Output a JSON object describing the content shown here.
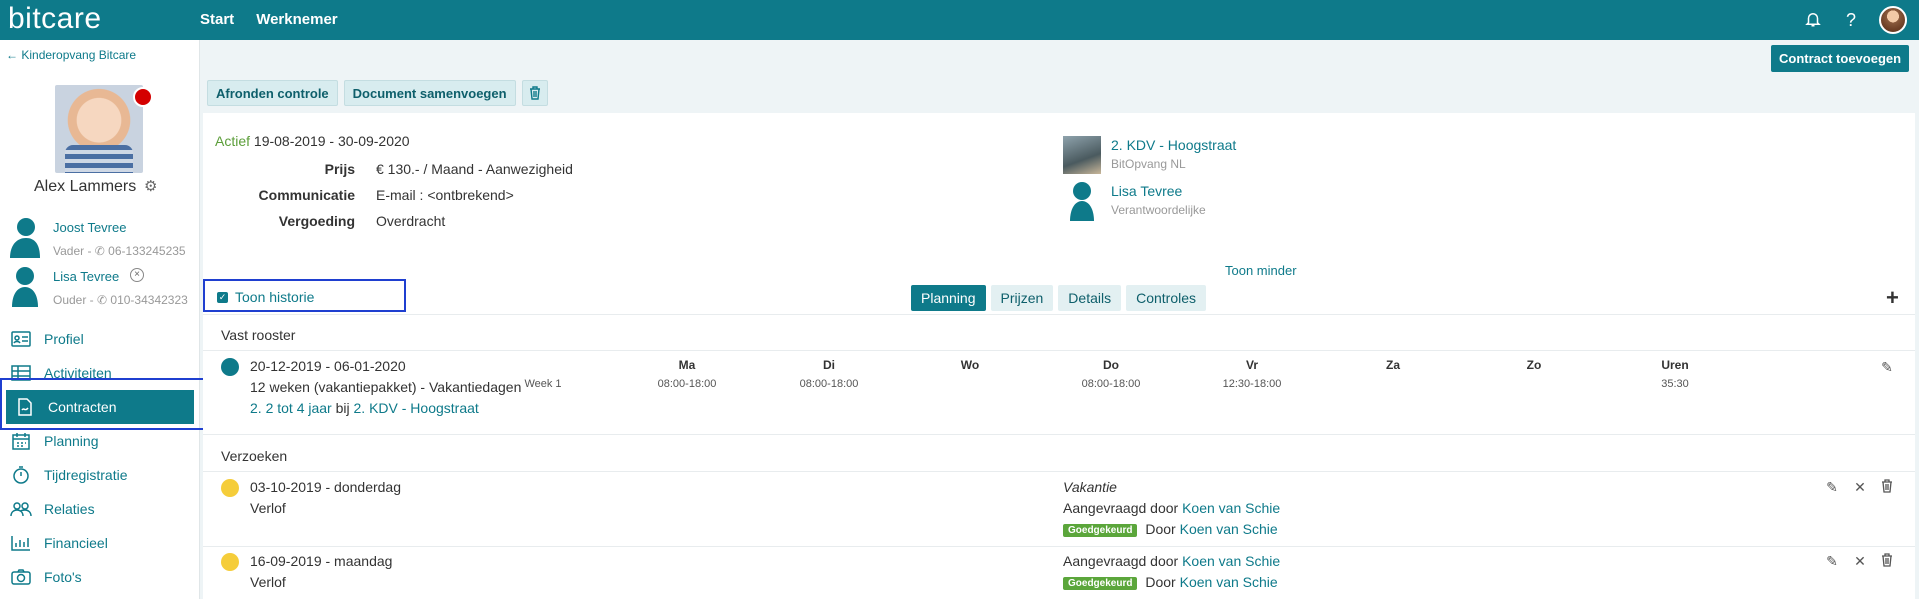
{
  "app": {
    "logo": "bitcare",
    "nav": [
      "Start",
      "Werknemer"
    ]
  },
  "sidebar": {
    "back_label": "Kinderopvang Bitcare",
    "child_name": "Alex Lammers",
    "parents": [
      {
        "name": "Joost Tevree",
        "role": "Vader - ✆ 06-133245235"
      },
      {
        "name": "Lisa Tevree",
        "role": "Ouder - ✆ 010-34342323"
      }
    ],
    "menu": [
      {
        "label": "Profiel",
        "icon": "profile-card-icon"
      },
      {
        "label": "Activiteiten",
        "icon": "table-icon"
      },
      {
        "label": "Contracten",
        "icon": "contract-icon",
        "active": true
      },
      {
        "label": "Planning",
        "icon": "calendar-icon"
      },
      {
        "label": "Tijdregistratie",
        "icon": "stopwatch-icon"
      },
      {
        "label": "Relaties",
        "icon": "people-icon"
      },
      {
        "label": "Financieel",
        "icon": "bar-chart-icon"
      },
      {
        "label": "Foto's",
        "icon": "camera-icon"
      }
    ]
  },
  "header": {
    "add_contract": "Contract toevoegen"
  },
  "toolbar": {
    "finish": "Afronden controle",
    "merge": "Document samenvoegen"
  },
  "contract": {
    "status": "Actief",
    "period": "19-08-2019 - 30-09-2020",
    "fields": [
      {
        "key": "Prijs",
        "value": "€ 130.- / Maand - Aanwezigheid"
      },
      {
        "key": "Communicatie",
        "value": "E-mail : <ontbrekend>"
      },
      {
        "key": "Vergoeding",
        "value": "Overdracht"
      }
    ],
    "location_name": "2. KDV - Hoogstraat",
    "location_org": "BitOpvang NL",
    "responsible_name": "Lisa Tevree",
    "responsible_role": "Verantwoordelijke",
    "toggle_less": "Toon minder",
    "history_label": "Toon historie",
    "tabs": [
      "Planning",
      "Prijzen",
      "Details",
      "Controles"
    ]
  },
  "schedule": {
    "title": "Vast rooster",
    "period": "20-12-2019 - 06-01-2020",
    "package": "12 weken (vakantiepakket) - Vakantiedagen",
    "group_link": "2. 2 tot 4 jaar",
    "group_mid": "bij",
    "location_link": "2. KDV - Hoogstraat",
    "week": "Week 1",
    "days": [
      "Ma",
      "Di",
      "Wo",
      "Do",
      "Vr",
      "Za",
      "Zo",
      "Uren"
    ],
    "times": [
      "08:00-18:00",
      "08:00-18:00",
      "",
      "08:00-18:00",
      "12:30-18:00",
      "",
      "",
      "35:30"
    ],
    "dot_color": "#0e7a8a"
  },
  "requests": {
    "title": "Verzoeken",
    "items": [
      {
        "date": "03-10-2019 - donderdag",
        "type": "Verlof",
        "reason": "Vakantie",
        "requested_prefix": "Aangevraagd door",
        "requested_by": "Koen van Schie",
        "badge": "Goedgekeurd",
        "approved_prefix": "Door",
        "approved_by": "Koen van Schie"
      },
      {
        "date": "16-09-2019 - maandag",
        "type": "Verlof",
        "reason": "",
        "requested_prefix": "Aangevraagd door",
        "requested_by": "Koen van Schie",
        "badge": "Goedgekeurd",
        "approved_prefix": "Door",
        "approved_by": "Koen van Schie"
      }
    ],
    "dot_color": "#f5cd3a"
  }
}
